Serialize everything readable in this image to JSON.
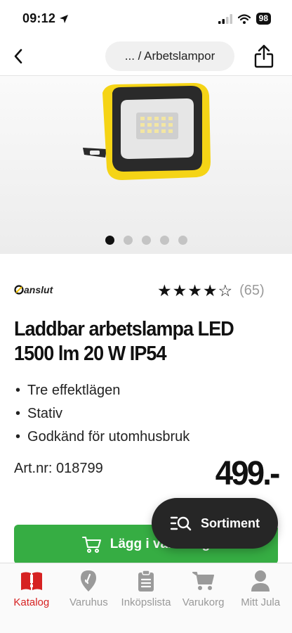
{
  "status_bar": {
    "time": "09:12",
    "battery": "98"
  },
  "nav": {
    "breadcrumb": "... / Arbetslampor"
  },
  "gallery": {
    "dot_count": 5,
    "active_index": 0
  },
  "product": {
    "brand": "anslut",
    "rating_stars": 4.5,
    "rating_count": "(65)",
    "title_line1": "Laddbar arbetslampa LED",
    "title_line2": "1500 lm 20 W IP54",
    "features": [
      "Tre effektlägen",
      "Stativ",
      "Godkänd för utomhusbruk"
    ],
    "article_number": "Art.nr: 018799",
    "price": "499.-"
  },
  "actions": {
    "add_to_cart": "Lägg i varukorg",
    "sortiment": "Sortiment"
  },
  "tabs": [
    {
      "label": "Katalog",
      "icon": "catalog-book-icon",
      "active": true
    },
    {
      "label": "Varuhus",
      "icon": "map-pin-icon",
      "active": false
    },
    {
      "label": "Inköpslista",
      "icon": "clipboard-list-icon",
      "active": false
    },
    {
      "label": "Varukorg",
      "icon": "cart-icon",
      "active": false
    },
    {
      "label": "Mitt Jula",
      "icon": "user-icon",
      "active": false
    }
  ],
  "colors": {
    "accent_red": "#d62222",
    "cart_green": "#36ad43",
    "pill_dark": "#262626"
  }
}
